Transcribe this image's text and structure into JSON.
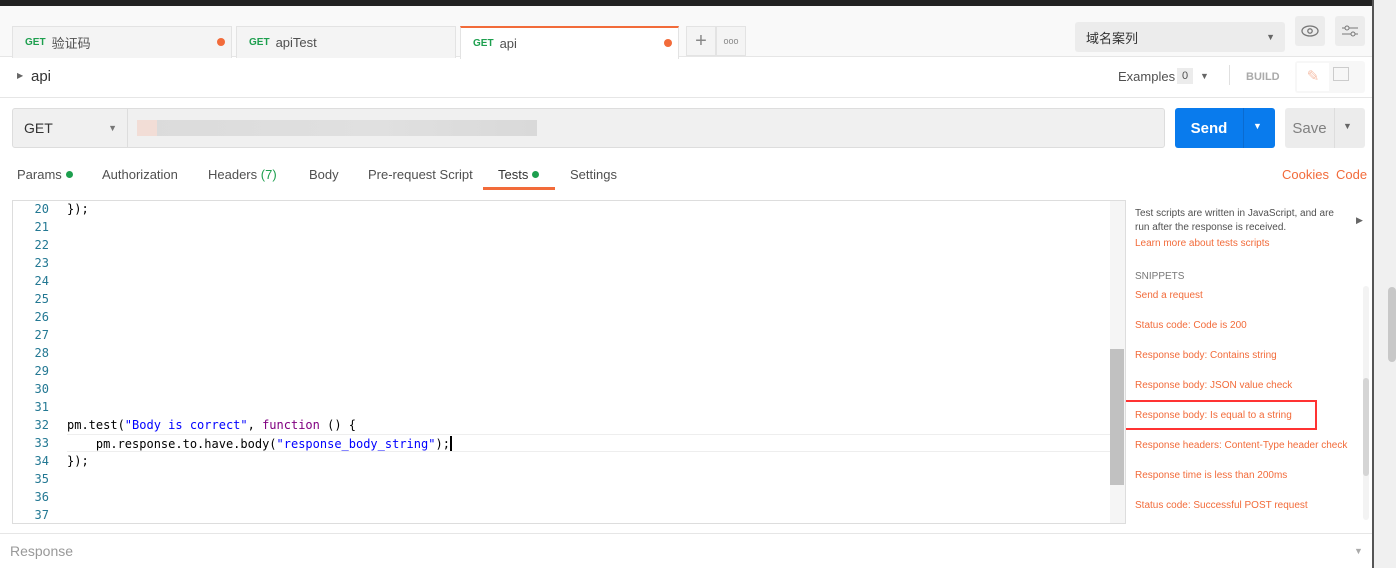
{
  "tabs": [
    {
      "method": "GET",
      "name": "验证码",
      "unsaved": true
    },
    {
      "method": "GET",
      "name": "apiTest",
      "unsaved": false
    },
    {
      "method": "GET",
      "name": "api",
      "unsaved": true,
      "active": true
    }
  ],
  "environment": "域名案列",
  "request_name": "api",
  "examples": {
    "label": "Examples",
    "count": "0"
  },
  "build_label": "BUILD",
  "method": "GET",
  "send_label": "Send",
  "save_label": "Save",
  "subtabs": {
    "params": "Params",
    "authorization": "Authorization",
    "headers": "Headers",
    "headers_count": "(7)",
    "body": "Body",
    "prerequest": "Pre-request Script",
    "tests": "Tests",
    "settings": "Settings"
  },
  "links": {
    "cookies": "Cookies",
    "code": "Code"
  },
  "editor": {
    "line_numbers": [
      "20",
      "21",
      "22",
      "23",
      "24",
      "25",
      "26",
      "27",
      "28",
      "29",
      "30",
      "31",
      "32",
      "33",
      "34",
      "35",
      "36",
      "37"
    ],
    "line20": "});",
    "l32_a": "pm.test(",
    "l32_str": "\"Body is correct\"",
    "l32_b": ", ",
    "l32_kw": "function",
    "l32_c": " () {",
    "l33_a": "    pm.response.to.have.body(",
    "l33_str": "\"response_body_string\"",
    "l33_b": ");",
    "l34": "});"
  },
  "side": {
    "description": "Test scripts are written in JavaScript, and are run after the response is received.",
    "learn_more": "Learn more about tests scripts",
    "snippets_heading": "SNIPPETS",
    "snippets": [
      "Send a request",
      "Status code: Code is 200",
      "Response body: Contains string",
      "Response body: JSON value check",
      "Response body: Is equal to a string",
      "Response headers: Content-Type header check",
      "Response time is less than 200ms",
      "Status code: Successful POST request"
    ]
  },
  "response_label": "Response",
  "colors": {
    "accent": "#f26b3a",
    "send": "#097bed",
    "get": "#1d9f4e",
    "highlight_box": "#ff3333"
  }
}
